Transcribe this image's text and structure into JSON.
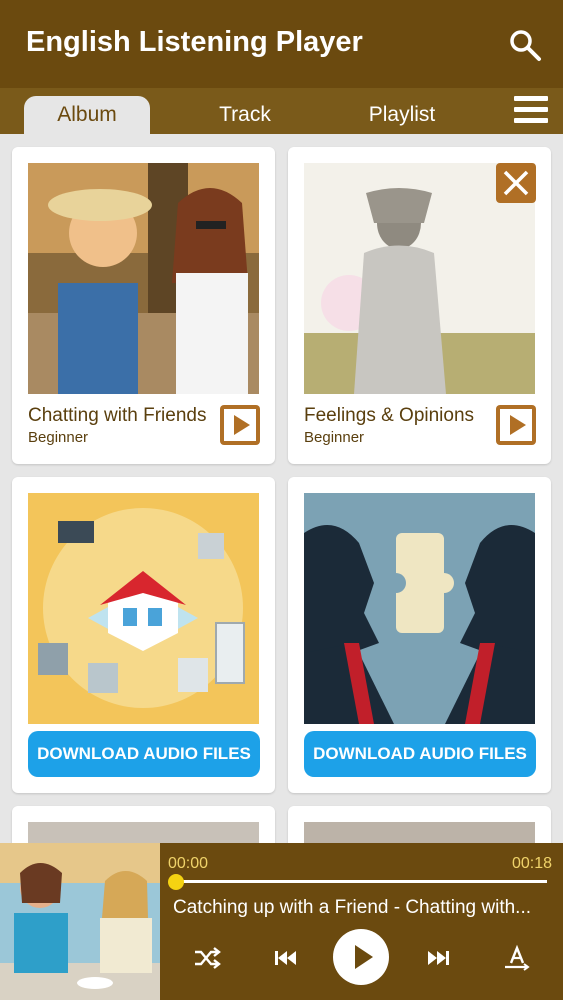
{
  "app": {
    "title": "English Listening Player"
  },
  "tabs": [
    {
      "label": "Album",
      "active": true
    },
    {
      "label": "Track",
      "active": false
    },
    {
      "label": "Playlist",
      "active": false
    }
  ],
  "albums": [
    {
      "title": "Chatting with Friends",
      "level": "Beginner",
      "action": "play"
    },
    {
      "title": "Feelings & Opinions",
      "level": "Beginner",
      "action": "play"
    },
    {
      "button": "DOWNLOAD AUDIO FILES"
    },
    {
      "button": "DOWNLOAD AUDIO FILES"
    }
  ],
  "player": {
    "current_time": "00:00",
    "duration": "00:18",
    "progress": 0.0,
    "track_title": "Catching up with a Friend - Chatting with..."
  },
  "icons": [
    "search-icon",
    "menu-icon",
    "close-icon",
    "play-icon",
    "shuffle-icon",
    "previous-icon",
    "next-icon",
    "font-size-icon"
  ],
  "colors": {
    "brand": "#6b4a0f",
    "accent": "#b06f25",
    "download": "#1da1e8",
    "progress_knob": "#f5d312"
  }
}
